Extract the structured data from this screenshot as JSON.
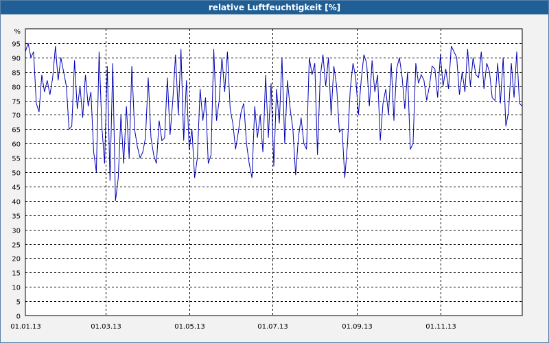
{
  "window": {
    "title": "relative Luftfeuchtigkeit [%]"
  },
  "chart_data": {
    "type": "line",
    "title": "relative Luftfeuchtigkeit [%]",
    "ylabel": "%",
    "xlabel": "",
    "ylim": [
      0,
      100
    ],
    "xlim": [
      "2013-01-01",
      "2013-12-31"
    ],
    "yticks": [
      0,
      5,
      10,
      15,
      20,
      25,
      30,
      35,
      40,
      45,
      50,
      55,
      60,
      65,
      70,
      75,
      80,
      85,
      90,
      95
    ],
    "xticks": [
      "01.01.13",
      "01.03.13",
      "01.05.13",
      "01.07.13",
      "01.09.13",
      "01.11.13"
    ],
    "grid": true,
    "line_color": "#0000b4",
    "series": [
      {
        "x": [
          "2013-01-01",
          "2013-01-03",
          "2013-01-05",
          "2013-01-07",
          "2013-01-09",
          "2013-01-11",
          "2013-01-13",
          "2013-01-15",
          "2013-01-17",
          "2013-01-19",
          "2013-01-21",
          "2013-01-23",
          "2013-01-25",
          "2013-01-27",
          "2013-01-29",
          "2013-01-31",
          "2013-02-02",
          "2013-02-04",
          "2013-02-06",
          "2013-02-08",
          "2013-02-10",
          "2013-02-12",
          "2013-02-14",
          "2013-02-16",
          "2013-02-18",
          "2013-02-20",
          "2013-02-22",
          "2013-02-24",
          "2013-02-26",
          "2013-02-28",
          "2013-03-02",
          "2013-03-04",
          "2013-03-06",
          "2013-03-08",
          "2013-03-10",
          "2013-03-12",
          "2013-03-14",
          "2013-03-16",
          "2013-03-18",
          "2013-03-20",
          "2013-03-22",
          "2013-03-24",
          "2013-03-26",
          "2013-03-28",
          "2013-03-30",
          "2013-04-01",
          "2013-04-03",
          "2013-04-05",
          "2013-04-07",
          "2013-04-09",
          "2013-04-11",
          "2013-04-13",
          "2013-04-15",
          "2013-04-17",
          "2013-04-19",
          "2013-04-21",
          "2013-04-23",
          "2013-04-25",
          "2013-04-27",
          "2013-04-29",
          "2013-05-01",
          "2013-05-03",
          "2013-05-05",
          "2013-05-07",
          "2013-05-09",
          "2013-05-11",
          "2013-05-13",
          "2013-05-15",
          "2013-05-17",
          "2013-05-19",
          "2013-05-21",
          "2013-05-23",
          "2013-05-25",
          "2013-05-27",
          "2013-05-29",
          "2013-05-31",
          "2013-06-02",
          "2013-06-04",
          "2013-06-06",
          "2013-06-08",
          "2013-06-10",
          "2013-06-12",
          "2013-06-14",
          "2013-06-16",
          "2013-06-18",
          "2013-06-20",
          "2013-06-22",
          "2013-06-24",
          "2013-06-26",
          "2013-06-28",
          "2013-06-30",
          "2013-07-02",
          "2013-07-04",
          "2013-07-06",
          "2013-07-08",
          "2013-07-10",
          "2013-07-12",
          "2013-07-14",
          "2013-07-16",
          "2013-07-18",
          "2013-07-20",
          "2013-07-22",
          "2013-07-24",
          "2013-07-26",
          "2013-07-28",
          "2013-07-30",
          "2013-08-01",
          "2013-08-03",
          "2013-08-05",
          "2013-08-07",
          "2013-08-09",
          "2013-08-11",
          "2013-08-13",
          "2013-08-15",
          "2013-08-17",
          "2013-08-19",
          "2013-08-21",
          "2013-08-23",
          "2013-08-25",
          "2013-08-27",
          "2013-08-29",
          "2013-08-31",
          "2013-09-02",
          "2013-09-04",
          "2013-09-06",
          "2013-09-08",
          "2013-09-10",
          "2013-09-12",
          "2013-09-14",
          "2013-09-16",
          "2013-09-18",
          "2013-09-20",
          "2013-09-22",
          "2013-09-24",
          "2013-09-26",
          "2013-09-28",
          "2013-09-30",
          "2013-10-02",
          "2013-10-04",
          "2013-10-06",
          "2013-10-08",
          "2013-10-10",
          "2013-10-12",
          "2013-10-14",
          "2013-10-16",
          "2013-10-18",
          "2013-10-20",
          "2013-10-22",
          "2013-10-24",
          "2013-10-26",
          "2013-10-28",
          "2013-10-30",
          "2013-11-01",
          "2013-11-03",
          "2013-11-05",
          "2013-11-07",
          "2013-11-09",
          "2013-11-11",
          "2013-11-13",
          "2013-11-15",
          "2013-11-17",
          "2013-11-19",
          "2013-11-21",
          "2013-11-23",
          "2013-11-25",
          "2013-11-27",
          "2013-11-29",
          "2013-12-01",
          "2013-12-03",
          "2013-12-05",
          "2013-12-07",
          "2013-12-09",
          "2013-12-11",
          "2013-12-13",
          "2013-12-15",
          "2013-12-17",
          "2013-12-19",
          "2013-12-21",
          "2013-12-23",
          "2013-12-25",
          "2013-12-27",
          "2013-12-29",
          "2013-12-31"
        ],
        "values": [
          92,
          95,
          90,
          92,
          74,
          71,
          84,
          78,
          82,
          77,
          83,
          94,
          82,
          90,
          85,
          80,
          65,
          66,
          89,
          72,
          80,
          69,
          84,
          73,
          78,
          57,
          50,
          92,
          66,
          53,
          87,
          47,
          88,
          40,
          48,
          70,
          53,
          73,
          55,
          87,
          65,
          59,
          55,
          57,
          62,
          83,
          62,
          56,
          53,
          68,
          61,
          62,
          83,
          63,
          75,
          91,
          70,
          93,
          61,
          82,
          58,
          65,
          48,
          55,
          79,
          68,
          76,
          53,
          56,
          93,
          68,
          75,
          90,
          78,
          92,
          72,
          67,
          58,
          64,
          71,
          74,
          60,
          53,
          48,
          73,
          62,
          70,
          57,
          84,
          62,
          81,
          52,
          79,
          67,
          90,
          60,
          82,
          72,
          65,
          49,
          62,
          69,
          60,
          58,
          90,
          84,
          88,
          56,
          83,
          91,
          80,
          90,
          70,
          87,
          80,
          64,
          65,
          48,
          60,
          79,
          88,
          83,
          70,
          82,
          91,
          88,
          73,
          89,
          78,
          84,
          61,
          74,
          79,
          70,
          88,
          68,
          86,
          90,
          83,
          72,
          85,
          58,
          60,
          88,
          81,
          84,
          82,
          75,
          80,
          87,
          86,
          76,
          91,
          80,
          86,
          79,
          94,
          92,
          90,
          77,
          85,
          78,
          93,
          80,
          90,
          84,
          83,
          92,
          79,
          88,
          85,
          76,
          75,
          88,
          74,
          90,
          66,
          71,
          88,
          76,
          92,
          74,
          73
        ]
      }
    ]
  }
}
